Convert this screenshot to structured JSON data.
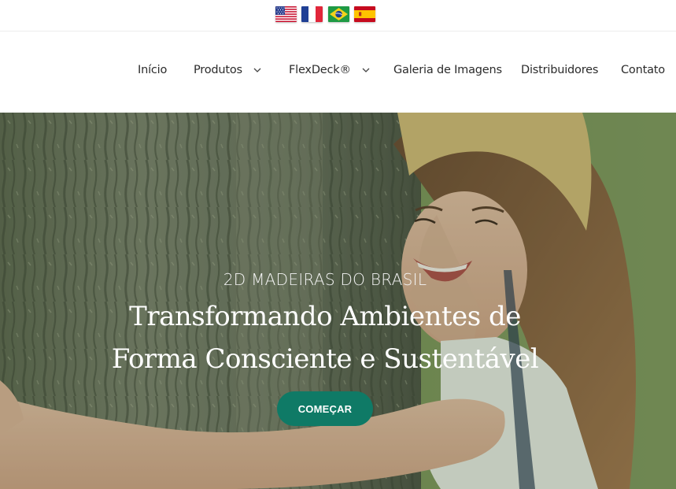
{
  "languages": [
    {
      "name": "English",
      "icon": "us-flag-icon"
    },
    {
      "name": "Français",
      "icon": "fr-flag-icon"
    },
    {
      "name": "Português",
      "icon": "br-flag-icon"
    },
    {
      "name": "Español",
      "icon": "es-flag-icon"
    }
  ],
  "nav": {
    "inicio": "Início",
    "produtos": "Produtos",
    "flexdeck": "FlexDeck®",
    "galeria": "Galeria de Imagens",
    "distribuidores": "Distribuidores",
    "contato": "Contato"
  },
  "hero": {
    "kicker": "2D MADEIRAS DO BRASIL",
    "title_line1": "Transformando Ambientes de",
    "title_line2": "Forma Consciente e Sustentável",
    "cta_label": "COMEÇAR"
  },
  "colors": {
    "accent": "#0f7a66",
    "nav_text": "#2b2b2b"
  }
}
